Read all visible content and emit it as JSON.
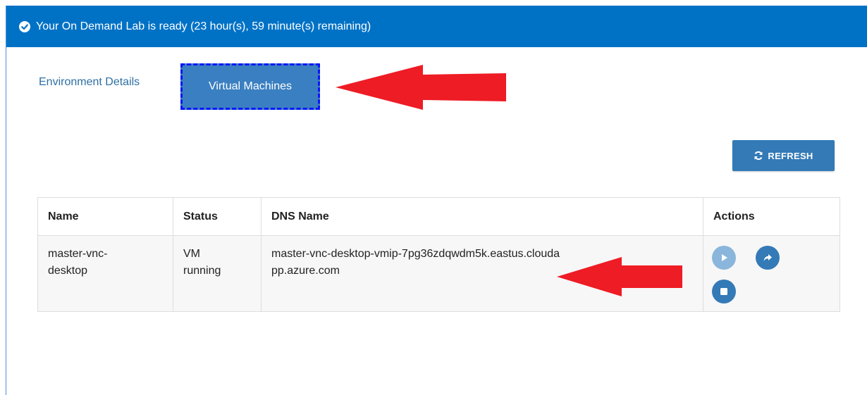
{
  "banner": {
    "message": "Your On Demand Lab is ready (23 hour(s), 59 minute(s) remaining)",
    "icon": "check-circle-icon",
    "color": "#0072c6"
  },
  "tabs": {
    "environment_details": "Environment Details",
    "virtual_machines": "Virtual Machines"
  },
  "toolbar": {
    "refresh_label": "REFRESH",
    "refresh_icon": "refresh-icon"
  },
  "table": {
    "headers": [
      "Name",
      "Status",
      "DNS Name",
      "Actions"
    ],
    "rows": [
      {
        "name": "master-vnc-desktop",
        "status": "VM running",
        "dns_name": "master-vnc-desktop-vmip-7pg36zdqwdm5k.eastus.cloudapp.azure.com",
        "actions": [
          "play-icon",
          "share-icon",
          "stop-icon"
        ]
      }
    ]
  },
  "annotations": {
    "arrow_color": "#ee1c25"
  }
}
